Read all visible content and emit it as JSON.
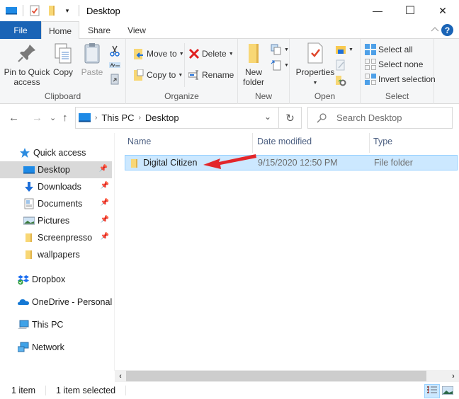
{
  "window": {
    "title": "Desktop",
    "controls": {
      "minimize": "—",
      "maximize": "☐",
      "close": "✕"
    }
  },
  "quick_access_toolbar": {
    "icons": [
      "this-pc-icon",
      "properties-icon",
      "new-folder-icon",
      "customize-dropdown-icon"
    ],
    "dropdown_glyph": "▾"
  },
  "tabs": [
    {
      "label": "File",
      "active": false
    },
    {
      "label": "Home",
      "active": true
    },
    {
      "label": "Share",
      "active": false
    },
    {
      "label": "View",
      "active": false
    }
  ],
  "ribbon_controls": {
    "collapse_glyph": "^",
    "help_glyph": "?"
  },
  "ribbon": {
    "clipboard": {
      "label": "Clipboard",
      "pin_line1": "Pin to Quick",
      "pin_line2": "access",
      "copy": "Copy",
      "paste": "Paste"
    },
    "organize": {
      "label": "Organize",
      "move_to": "Move to",
      "copy_to": "Copy to",
      "delete": "Delete",
      "rename": "Rename"
    },
    "new": {
      "label": "New",
      "new_folder_line1": "New",
      "new_folder_line2": "folder"
    },
    "open": {
      "label": "Open",
      "properties": "Properties"
    },
    "select": {
      "label": "Select",
      "select_all": "Select all",
      "select_none": "Select none",
      "invert_selection": "Invert selection"
    }
  },
  "navigation": {
    "back": "←",
    "forward": "→",
    "recent": "⌄",
    "up": "↑",
    "breadcrumb": [
      "This PC",
      "Desktop"
    ],
    "breadcrumb_sep": "›",
    "address_dropdown": "⌄",
    "refresh": "↻",
    "search_placeholder": "Search Desktop",
    "search_glyph": "⚲"
  },
  "sidebar": {
    "quick_access": "Quick access",
    "items": [
      {
        "label": "Desktop",
        "icon": "desktop-icon",
        "pinned": true,
        "selected": true
      },
      {
        "label": "Downloads",
        "icon": "downloads-icon",
        "pinned": true
      },
      {
        "label": "Documents",
        "icon": "documents-icon",
        "pinned": true
      },
      {
        "label": "Pictures",
        "icon": "pictures-icon",
        "pinned": true
      },
      {
        "label": "Screenpresso",
        "icon": "folder-icon",
        "pinned": true
      },
      {
        "label": "wallpapers",
        "icon": "folder-icon",
        "pinned": false
      }
    ],
    "locations": [
      {
        "label": "Dropbox",
        "icon": "dropbox-icon"
      },
      {
        "label": "OneDrive - Personal",
        "icon": "onedrive-icon"
      },
      {
        "label": "This PC",
        "icon": "this-pc-icon"
      },
      {
        "label": "Network",
        "icon": "network-icon"
      }
    ]
  },
  "file_list": {
    "columns": [
      "Name",
      "Date modified",
      "Type"
    ],
    "rows": [
      {
        "name": "Digital Citizen",
        "date_modified": "9/15/2020 12:50 PM",
        "type": "File folder",
        "selected": true
      }
    ]
  },
  "scrollbar": {
    "left": "‹",
    "right": "›"
  },
  "status_bar": {
    "item_count": "1 item",
    "selection": "1 item selected"
  },
  "colors": {
    "accent": "#1a64b6",
    "selection_bg": "#cce8ff",
    "selection_border": "#99d1ff",
    "annotation_arrow": "#e3262a"
  }
}
